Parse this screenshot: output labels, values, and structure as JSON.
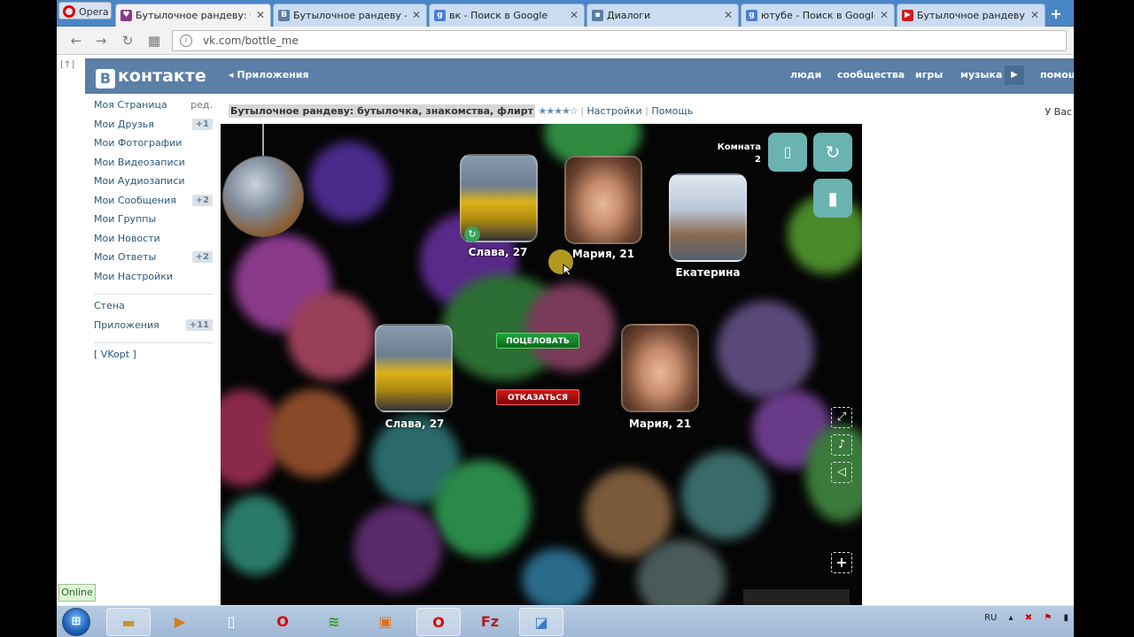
{
  "browser": {
    "opera_label": "Opera",
    "tabs": [
      {
        "title": "Бутылочное рандеву: бу",
        "icon": "vk-heart-icon",
        "active": true
      },
      {
        "title": "Бутылочное рандеву - »",
        "icon": "vk-icon",
        "active": false
      },
      {
        "title": "вк - Поиск в Google",
        "icon": "google-icon",
        "active": false
      },
      {
        "title": "Диалоги",
        "icon": "dialogs-icon",
        "active": false
      },
      {
        "title": "ютубе - Поиск в Google",
        "icon": "google-icon",
        "active": false
      },
      {
        "title": "Бутылочное рандеву: бу",
        "icon": "youtube-icon",
        "active": false
      }
    ],
    "new_tab": "+",
    "url": "vk.com/bottle_me"
  },
  "vk": {
    "logo": "контакте",
    "logo_letter": "В",
    "apps_link": "Приложения",
    "nav": [
      "люди",
      "сообщества",
      "игры",
      "музыка",
      "помощ"
    ],
    "left_tag": "[↑]",
    "sidebar": [
      {
        "label": "Моя Страница",
        "badge": "ред."
      },
      {
        "label": "Мои Друзья",
        "badge": "+1"
      },
      {
        "label": "Мои Фотографии",
        "badge": ""
      },
      {
        "label": "Мои Видеозаписи",
        "badge": ""
      },
      {
        "label": "Мои Аудиозаписи",
        "badge": ""
      },
      {
        "label": "Мои Сообщения",
        "badge": "+2"
      },
      {
        "label": "Мои Группы",
        "badge": ""
      },
      {
        "label": "Мои Новости",
        "badge": ""
      },
      {
        "label": "Мои Ответы",
        "badge": "+2"
      },
      {
        "label": "Мои Настройки",
        "badge": ""
      }
    ],
    "sidebar2": [
      {
        "label": "Стена",
        "badge": ""
      },
      {
        "label": "Приложения",
        "badge": "+11"
      }
    ],
    "vkopt": "[ VKopt ]",
    "app_title": "Бутылочное рандеву: бутылочка, знакомства, флирт",
    "stars": "★★★★☆",
    "settings": "Настройки",
    "help": "Помощь",
    "u_vas": "У Вас"
  },
  "game": {
    "room_label": "Комната",
    "room_number": "2",
    "players_top": [
      {
        "name": "Слава, 27",
        "kind": "car"
      },
      {
        "name": "Мария, 21",
        "kind": "girl"
      },
      {
        "name": "Екатерина",
        "kind": "horse"
      }
    ],
    "pair": [
      {
        "name": "Слава, 27",
        "kind": "car"
      },
      {
        "name": "Мария, 21",
        "kind": "girl"
      }
    ],
    "kiss_button": "ПОЦЕЛОВАТЬ",
    "refuse_button": "ОТКАЗАТЬСЯ"
  },
  "status": {
    "online": "Online",
    "language": "RU"
  },
  "colors": {
    "vk_header": "#5b7fa6",
    "tab_strip": "#4a86c6",
    "teal_button": "#6bb3b0",
    "kiss_green": "#1ea43a",
    "refuse_red": "#d01818"
  }
}
